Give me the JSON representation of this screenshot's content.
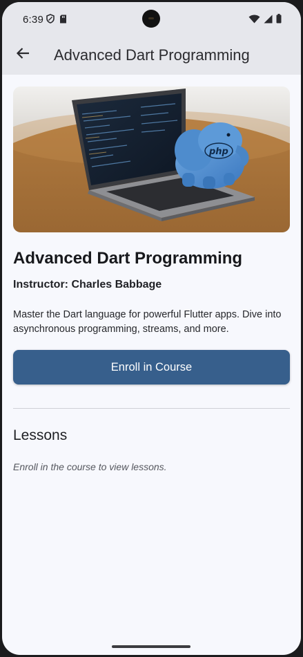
{
  "status_bar": {
    "time": "6:39",
    "left_icons": [
      "shield-icon",
      "sd-card-icon"
    ],
    "right_icons": [
      "wifi-icon",
      "cell-signal-icon",
      "battery-icon"
    ]
  },
  "app_bar": {
    "title": "Advanced Dart Programming",
    "back_icon": "arrow-back-icon"
  },
  "course": {
    "image_description": "php-elephant-on-laptop",
    "title": "Advanced Dart Programming",
    "instructor": "Instructor: Charles Babbage",
    "description": "Master the Dart language for powerful Flutter apps. Dive into asynchronous programming, streams, and more.",
    "enroll_label": "Enroll in Course"
  },
  "lessons": {
    "heading": "Lessons",
    "empty_text": "Enroll in the course to view lessons."
  },
  "colors": {
    "primary": "#375f8c",
    "app_bar_bg": "#e6e7ec",
    "page_bg": "#f7f8fd"
  }
}
